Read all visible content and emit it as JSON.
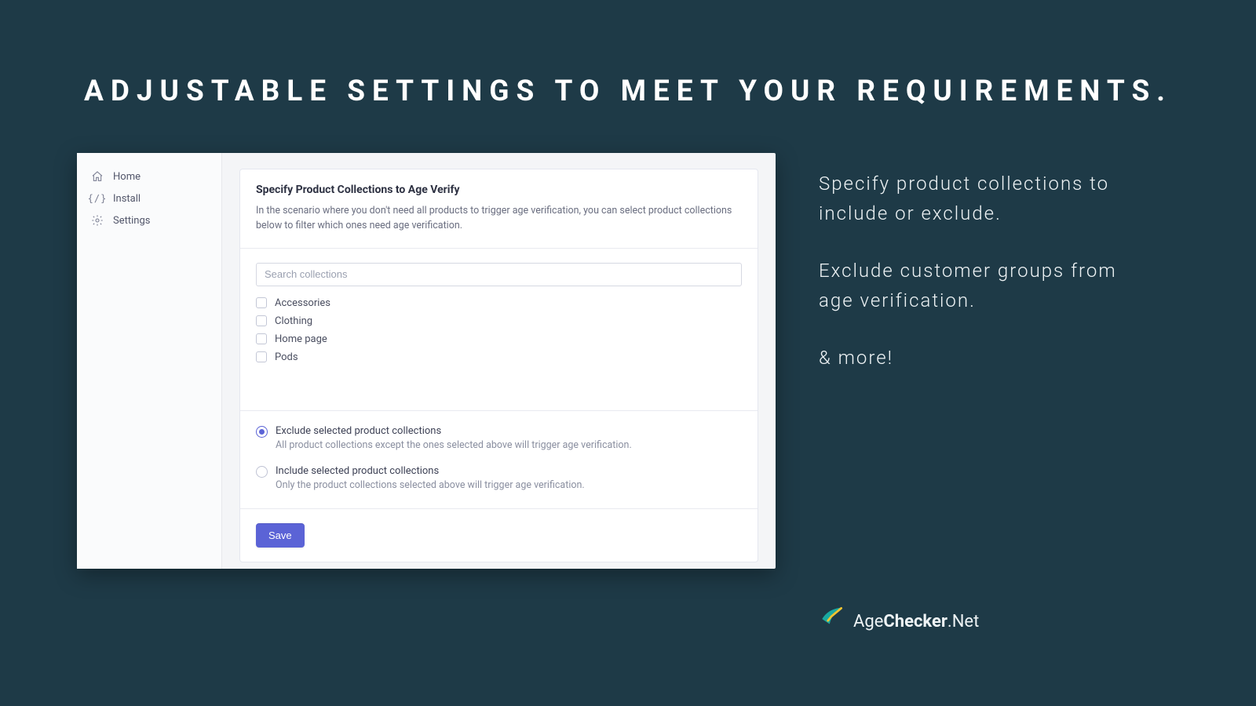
{
  "headline": "ADJUSTABLE SETTINGS TO MEET YOUR REQUIREMENTS.",
  "sidebar": {
    "items": [
      {
        "label": "Home"
      },
      {
        "label": "Install"
      },
      {
        "label": "Settings"
      }
    ]
  },
  "panel": {
    "title": "Specify Product Collections to Age Verify",
    "description": "In the scenario where you don't need all products to trigger age verification, you can select product collections below to filter which ones need age verification.",
    "search_placeholder": "Search collections",
    "collections": [
      {
        "label": "Accessories"
      },
      {
        "label": "Clothing"
      },
      {
        "label": "Home page"
      },
      {
        "label": "Pods"
      }
    ],
    "options": [
      {
        "label": "Exclude selected product collections",
        "sub": "All product collections except the ones selected above will trigger age verification.",
        "selected": true
      },
      {
        "label": "Include selected product collections",
        "sub": "Only the product collections selected above will trigger age verification.",
        "selected": false
      }
    ],
    "save_label": "Save"
  },
  "promo": {
    "p1": "Specify product collections to include or exclude.",
    "p2": "Exclude customer groups from age verification.",
    "p3": "& more!"
  },
  "brand": {
    "age": "Age",
    "checker": "Checker",
    "net": ".Net"
  }
}
